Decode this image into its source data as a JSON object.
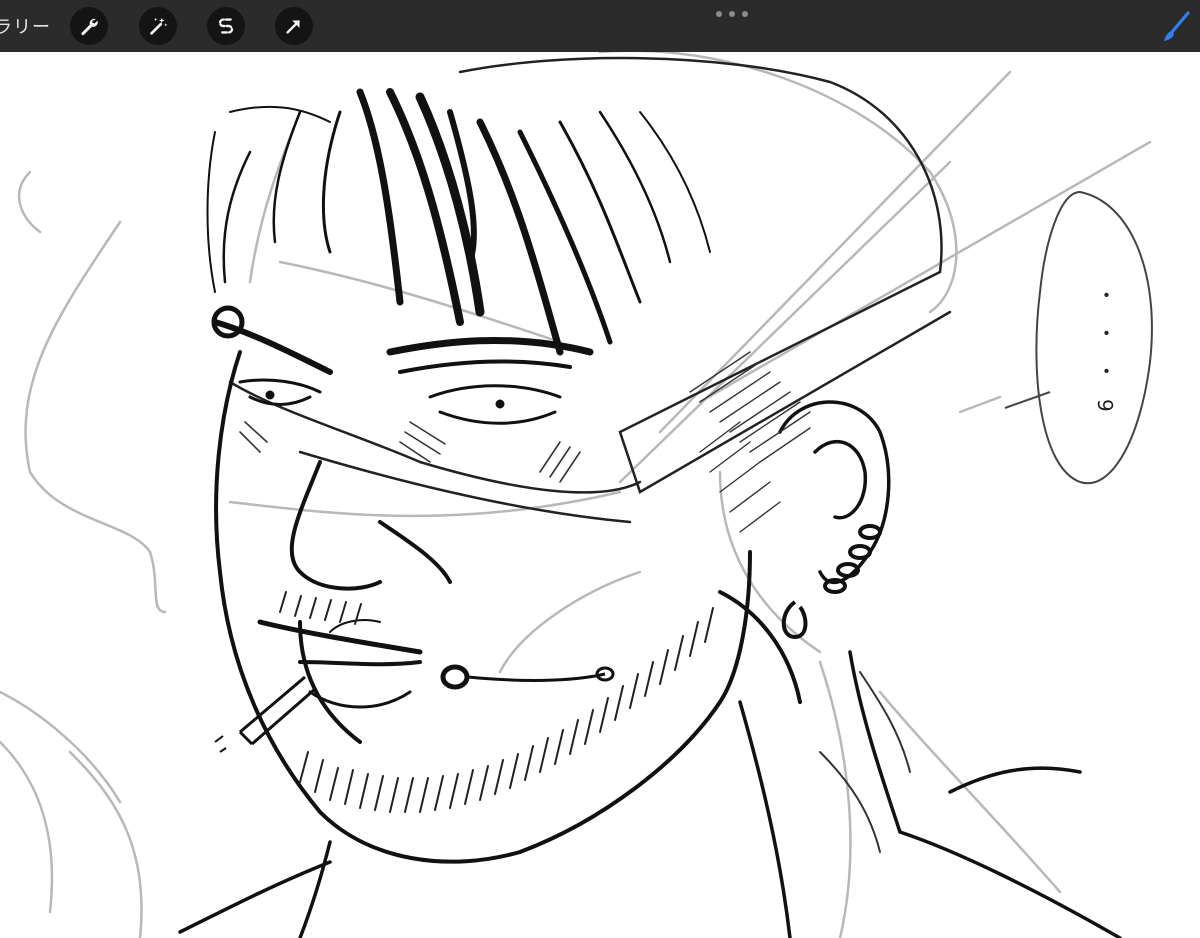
{
  "toolbar": {
    "gallery_label": "ラリー",
    "tools": [
      {
        "name": "actions",
        "icon": "wrench-icon"
      },
      {
        "name": "adjustments",
        "icon": "magic-wand-icon"
      },
      {
        "name": "selection",
        "icon": "selection-s-icon"
      },
      {
        "name": "transform",
        "icon": "arrow-cursor-icon"
      }
    ],
    "more_icon": "more-dots-icon",
    "brush_icon": "brush-icon",
    "accent_color": "#2f7ff0"
  },
  "canvas": {
    "speech_bubble_text": "・・・9"
  }
}
